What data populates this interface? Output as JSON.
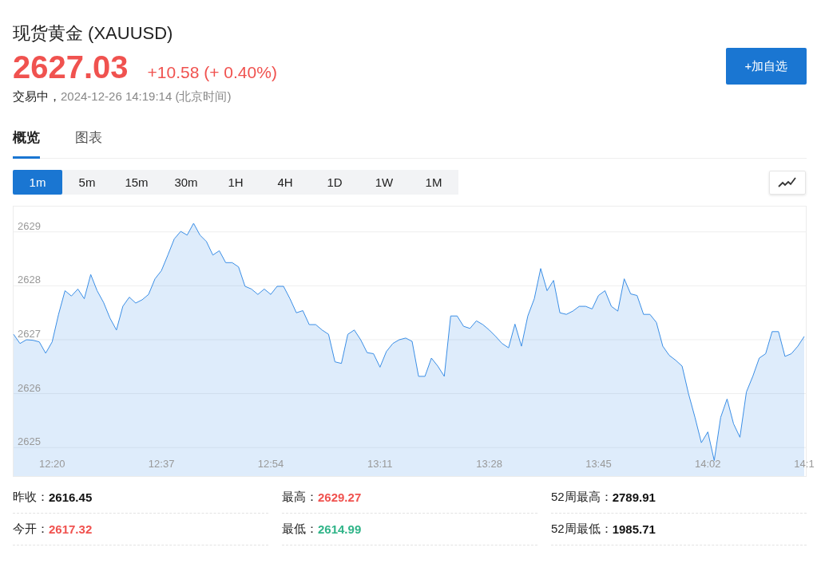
{
  "quote": {
    "title": "现货黄金 (XAUUSD)",
    "price": "2627.03",
    "change": "+10.58 (+ 0.40%)",
    "color": "#f0524f",
    "status": "交易中，",
    "time": "2024-12-26 14:19:14 (北京时间)",
    "watch_button": "+加自选"
  },
  "tabs": [
    {
      "label": "概览",
      "selected": true
    },
    {
      "label": "图表",
      "selected": false
    }
  ],
  "periods": [
    {
      "label": "1m",
      "selected": true
    },
    {
      "label": "5m",
      "selected": false
    },
    {
      "label": "15m",
      "selected": false
    },
    {
      "label": "30m",
      "selected": false
    },
    {
      "label": "1H",
      "selected": false
    },
    {
      "label": "4H",
      "selected": false
    },
    {
      "label": "1D",
      "selected": false
    },
    {
      "label": "1W",
      "selected": false
    },
    {
      "label": "1M",
      "selected": false
    }
  ],
  "chart": {
    "chart_data": {
      "type": "area",
      "ylim": [
        2624.47,
        2629.47
      ],
      "yticks": [
        2625,
        2626,
        2627,
        2628,
        2629
      ],
      "grid": true,
      "categories": [
        null,
        null,
        null,
        null,
        null,
        null,
        "12:20",
        null,
        null,
        null,
        null,
        null,
        null,
        null,
        null,
        null,
        null,
        null,
        null,
        null,
        null,
        null,
        null,
        "12:37",
        null,
        null,
        null,
        null,
        null,
        null,
        null,
        null,
        null,
        null,
        null,
        null,
        null,
        null,
        null,
        null,
        "12:54",
        null,
        null,
        null,
        null,
        null,
        null,
        null,
        null,
        null,
        null,
        null,
        null,
        null,
        null,
        null,
        null,
        "13:11",
        null,
        null,
        null,
        null,
        null,
        null,
        null,
        null,
        null,
        null,
        null,
        null,
        null,
        null,
        null,
        null,
        "13:28",
        null,
        null,
        null,
        null,
        null,
        null,
        null,
        null,
        null,
        null,
        null,
        null,
        null,
        null,
        null,
        null,
        "13:45",
        null,
        null,
        null,
        null,
        null,
        null,
        null,
        null,
        null,
        null,
        null,
        null,
        null,
        null,
        null,
        null,
        "14:02",
        null,
        null,
        null,
        null,
        null,
        null,
        null,
        null,
        null,
        null,
        null,
        null,
        null,
        null,
        "14:1"
      ],
      "series": [
        {
          "color": "#3a8ee6",
          "values": [
            2627.1,
            2626.93,
            2627.0,
            2626.99,
            2626.96,
            2626.75,
            2626.96,
            2627.47,
            2627.91,
            2627.81,
            2627.94,
            2627.76,
            2628.21,
            2627.91,
            2627.69,
            2627.4,
            2627.18,
            2627.62,
            2627.79,
            2627.68,
            2627.74,
            2627.84,
            2628.13,
            2628.28,
            2628.57,
            2628.87,
            2629.01,
            2628.94,
            2629.16,
            2628.94,
            2628.82,
            2628.57,
            2628.65,
            2628.43,
            2628.43,
            2628.35,
            2627.99,
            2627.94,
            2627.84,
            2627.94,
            2627.84,
            2627.99,
            2627.99,
            2627.76,
            2627.5,
            2627.54,
            2627.28,
            2627.28,
            2627.18,
            2627.1,
            2626.59,
            2626.56,
            2627.1,
            2627.18,
            2627.0,
            2626.76,
            2626.74,
            2626.49,
            2626.78,
            2626.93,
            2627.0,
            2627.03,
            2626.97,
            2626.32,
            2626.32,
            2626.66,
            2626.51,
            2626.32,
            2627.44,
            2627.44,
            2627.25,
            2627.21,
            2627.35,
            2627.28,
            2627.18,
            2627.06,
            2626.93,
            2626.85,
            2627.29,
            2626.88,
            2627.44,
            2627.76,
            2628.32,
            2627.91,
            2628.1,
            2627.5,
            2627.47,
            2627.53,
            2627.62,
            2627.62,
            2627.57,
            2627.82,
            2627.91,
            2627.62,
            2627.53,
            2628.13,
            2627.85,
            2627.82,
            2627.47,
            2627.47,
            2627.32,
            2626.88,
            2626.71,
            2626.62,
            2626.51,
            2626.0,
            2625.56,
            2625.09,
            2625.29,
            2624.76,
            2625.56,
            2625.9,
            2625.44,
            2625.19,
            2626.03,
            2626.32,
            2626.66,
            2626.74,
            2627.15,
            2627.15,
            2626.69,
            2626.74,
            2626.88,
            2627.06
          ]
        }
      ]
    }
  },
  "stats": [
    {
      "label": "昨收：",
      "value": "2616.45",
      "color": "#111111"
    },
    {
      "label": "最高：",
      "value": "2629.27",
      "color": "#f0524f"
    },
    {
      "label": "52周最高：",
      "value": "2789.91",
      "color": "#111111"
    },
    {
      "label": "今开：",
      "value": "2617.32",
      "color": "#f0524f"
    },
    {
      "label": "最低：",
      "value": "2614.99",
      "color": "#2fb488"
    },
    {
      "label": "52周最低：",
      "value": "1985.71",
      "color": "#111111"
    }
  ]
}
